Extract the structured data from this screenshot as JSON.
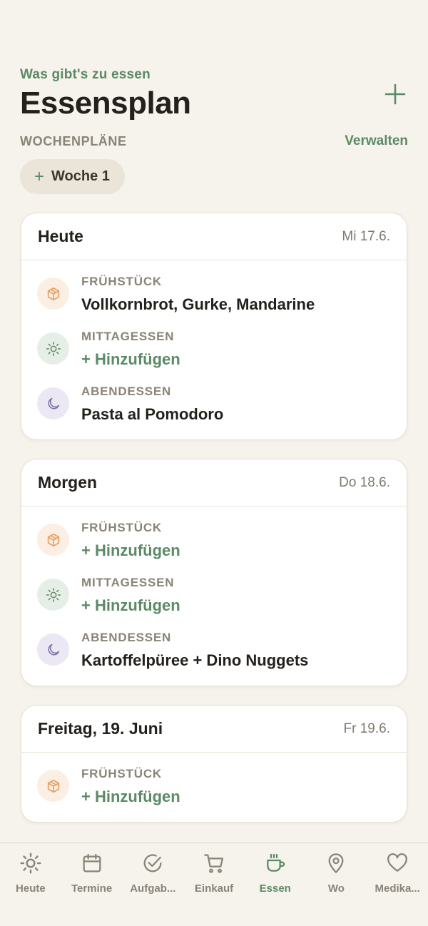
{
  "header": {
    "kicker": "Was gibt's zu essen",
    "title": "Essensplan"
  },
  "plans": {
    "section_label": "WOCHENPLÄNE",
    "manage_label": "Verwalten",
    "chip_label": "Woche 1"
  },
  "meal_types": {
    "breakfast": "FRÜHSTÜCK",
    "lunch": "MITTAGESSEN",
    "dinner": "ABENDESSEN"
  },
  "days": [
    {
      "name": "Heute",
      "date": "Mi 17.6.",
      "meals": [
        {
          "type": "FRÜHSTÜCK",
          "value": "Vollkornbrot, Gurke, Mandarine",
          "empty": false
        },
        {
          "type": "MITTAGESSEN",
          "value": "+ Hinzufügen",
          "empty": true
        },
        {
          "type": "ABENDESSEN",
          "value": "Pasta al Pomodoro",
          "empty": false
        }
      ]
    },
    {
      "name": "Morgen",
      "date": "Do 18.6.",
      "meals": [
        {
          "type": "FRÜHSTÜCK",
          "value": "+ Hinzufügen",
          "empty": true
        },
        {
          "type": "MITTAGESSEN",
          "value": "+ Hinzufügen",
          "empty": true
        },
        {
          "type": "ABENDESSEN",
          "value": "Kartoffelpüree + Dino Nuggets",
          "empty": false
        }
      ]
    },
    {
      "name": "Freitag, 19. Juni",
      "date": "Fr 19.6.",
      "meals": [
        {
          "type": "FRÜHSTÜCK",
          "value": "+ Hinzufügen",
          "empty": true
        }
      ]
    }
  ],
  "tabs": [
    {
      "label": "Heute",
      "icon": "sun-icon"
    },
    {
      "label": "Termine",
      "icon": "calendar-icon"
    },
    {
      "label": "Aufgab...",
      "icon": "check-circle-icon"
    },
    {
      "label": "Einkauf",
      "icon": "cart-icon"
    },
    {
      "label": "Essen",
      "icon": "coffee-cup-icon",
      "active": true
    },
    {
      "label": "Wo",
      "icon": "map-pin-icon"
    },
    {
      "label": "Medika...",
      "icon": "heart-icon"
    }
  ],
  "colors": {
    "accent": "#5b8a66",
    "background": "#f6f2ec",
    "breakfast": "#e6a064",
    "lunch": "#6b8f72",
    "dinner": "#8276a6"
  }
}
